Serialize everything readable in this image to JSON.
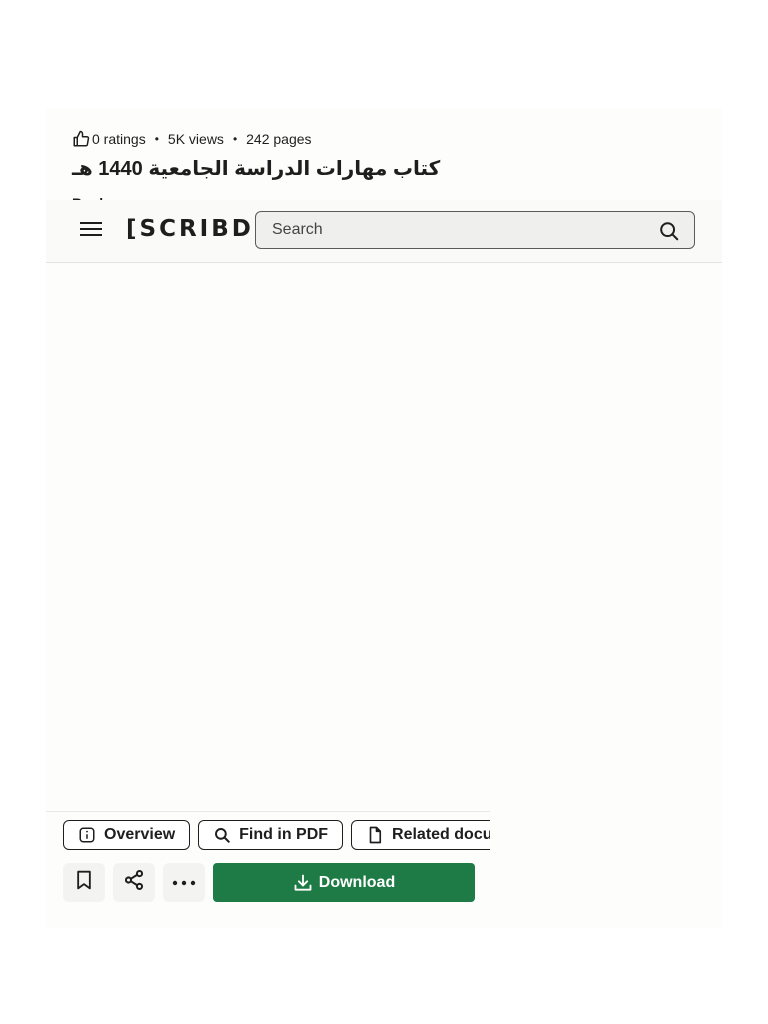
{
  "document": {
    "ratings": "0 ratings",
    "views": "5K views",
    "pages": "242 pages",
    "separator": "•",
    "title": "كتاب مهارات الدراسة الجامعية 1440 هـ",
    "author_partial": "Book"
  },
  "header": {
    "logo": "[SCRIBD]",
    "search_placeholder": "Search"
  },
  "tabs": [
    {
      "label": "Overview",
      "icon": "info-icon"
    },
    {
      "label": "Find in PDF",
      "icon": "search-icon"
    },
    {
      "label": "Related documents",
      "icon": "document-icon"
    }
  ],
  "actions": {
    "save_icon": "bookmark-icon",
    "share_icon": "share-icon",
    "more_icon": "more-dots-icon",
    "download_label": "Download"
  },
  "colors": {
    "brand_green": "#1e7b45",
    "text": "#1e1e1e"
  }
}
